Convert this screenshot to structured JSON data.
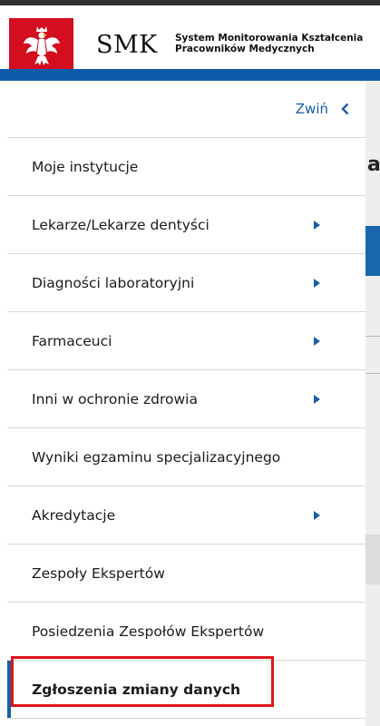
{
  "header": {
    "logo_text": "SMK",
    "subtitle_line1": "System Monitorowania Kształcenia",
    "subtitle_line2": "Pracowników Medycznych",
    "emblem_icon": "polish-eagle-icon"
  },
  "sidebar": {
    "collapse_label": "Zwiń",
    "collapse_icon": "chevron-left-icon",
    "items": [
      {
        "label": "Moje instytucje",
        "has_submenu": false
      },
      {
        "label": "Lekarze/Lekarze dentyści",
        "has_submenu": true
      },
      {
        "label": "Diagności laboratoryjni",
        "has_submenu": true
      },
      {
        "label": "Farmaceuci",
        "has_submenu": true
      },
      {
        "label": "Inni w ochronie zdrowia",
        "has_submenu": true
      },
      {
        "label": "Wyniki egzaminu specjalizacyjnego",
        "has_submenu": false
      },
      {
        "label": "Akredytacje",
        "has_submenu": true
      },
      {
        "label": "Zespoły Ekspertów",
        "has_submenu": false
      },
      {
        "label": "Posiedzenia Zespołów Ekspertów",
        "has_submenu": false
      },
      {
        "label": "Zgłoszenia zmiany danych",
        "has_submenu": false,
        "active": true
      }
    ]
  },
  "main": {
    "heading_fragment": "a"
  },
  "colors": {
    "brand_blue": "#0d5ca8",
    "emblem_red": "#d40e1f",
    "highlight_red": "#e0151b"
  }
}
